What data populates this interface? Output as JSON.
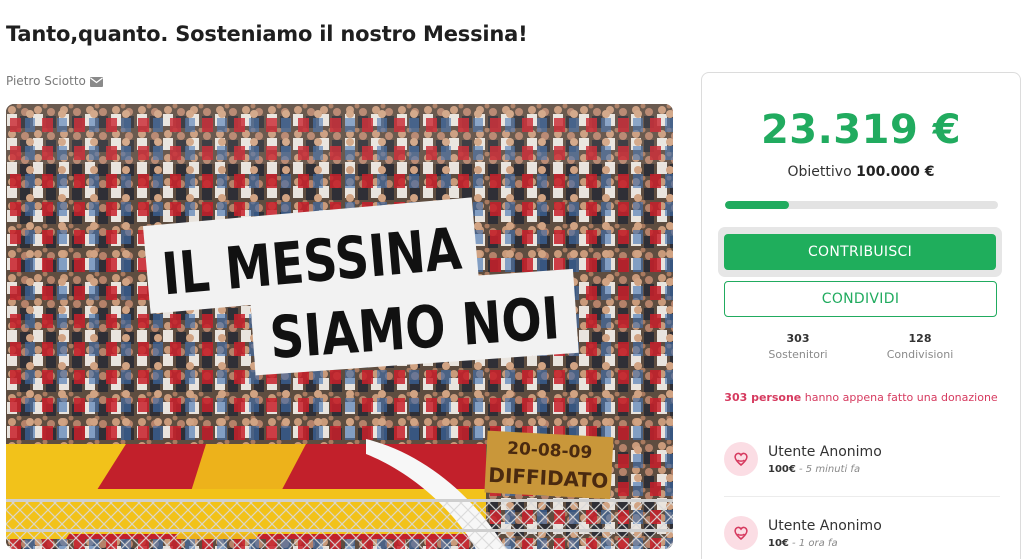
{
  "campaign": {
    "title": "Tanto,quanto. Sosteniamo il nostro Messina!",
    "author": "Pietro Sciotto"
  },
  "photo": {
    "banner_line_1": "IL MESSINA",
    "banner_line_2": "SIAMO NOI",
    "banner_small_date": "20-08-09",
    "banner_small_text": "DIFFIDATO"
  },
  "funding": {
    "raised": "23.319 €",
    "goal_label": "Obiettivo",
    "goal_amount": "100.000 €",
    "progress_fraction": 0.2332,
    "accent_color": "#21ab5f"
  },
  "actions": {
    "contribute_label": "CONTRIBUISCI",
    "share_label": "CONDIVIDI"
  },
  "stats": [
    {
      "value": "303",
      "label": "Sostenitori"
    },
    {
      "value": "128",
      "label": "Condivisioni"
    }
  ],
  "recent": {
    "count_text": "303 persone",
    "rest_text": " hanno appena fatto una donazione"
  },
  "donations": [
    {
      "name": "Utente Anonimo",
      "amount": "100€",
      "time": " - 5 minuti fa",
      "icon": "heart-hand-icon"
    },
    {
      "name": "Utente Anonimo",
      "amount": "10€",
      "time": " - 1 ora fa",
      "icon": "heart-hand-icon"
    }
  ]
}
